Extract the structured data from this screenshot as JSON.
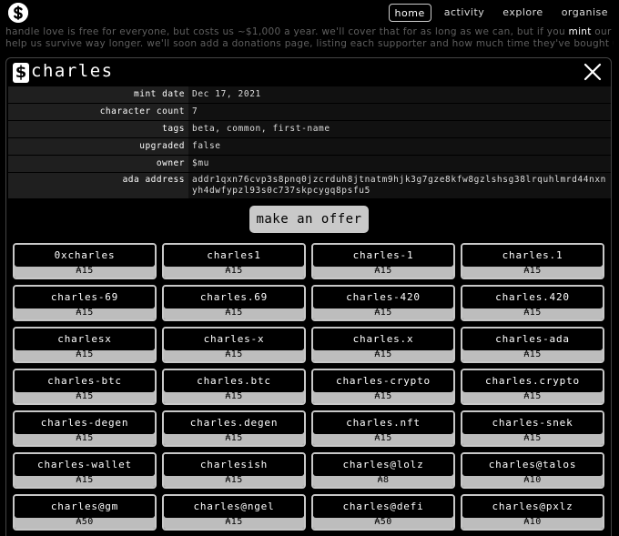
{
  "nav": {
    "logo_icon": "handle-logo-icon",
    "items": [
      {
        "label": "home",
        "active": true
      },
      {
        "label": "activity",
        "active": false
      },
      {
        "label": "explore",
        "active": false
      },
      {
        "label": "organise",
        "active": false
      }
    ]
  },
  "background": {
    "line1_before": "handle love is free for everyone, but costs us ~$1,000 a year. we'll cover that for as long as we can, but if you ",
    "line1_highlight": "mint",
    "line1_after": " our sub-handles it'll",
    "line2": "help us survive way longer. we'll soon add a donations page, listing each supporter and how much time they've bought us."
  },
  "modal": {
    "currency_symbol": "$",
    "handle_name": "charles",
    "close_icon": "close-icon",
    "info": {
      "mint_date": {
        "key": "mint date",
        "value": "Dec 17, 2021"
      },
      "character_count": {
        "key": "character count",
        "value": "7"
      },
      "tags": {
        "key": "tags",
        "value": "beta, common, first-name"
      },
      "upgraded": {
        "key": "upgraded",
        "value": "false"
      },
      "owner": {
        "key": "owner",
        "value": "$mu"
      },
      "ada_address": {
        "key": "ada address",
        "value": "addr1qxn76cvp3s8pnq0jzcrduh8jtnatm9hjk3g7gze8kfw8gzlshsg38lrquhlmrd44nxnyh4dwfypzl93s0c737skpcygq8psfu5"
      }
    },
    "offer_button": "make an offer",
    "sub_handles": [
      {
        "name": "0xcharles",
        "price": "₳15"
      },
      {
        "name": "charles1",
        "price": "₳15"
      },
      {
        "name": "charles-1",
        "price": "₳15"
      },
      {
        "name": "charles.1",
        "price": "₳15"
      },
      {
        "name": "charles-69",
        "price": "₳15"
      },
      {
        "name": "charles.69",
        "price": "₳15"
      },
      {
        "name": "charles-420",
        "price": "₳15"
      },
      {
        "name": "charles.420",
        "price": "₳15"
      },
      {
        "name": "charlesx",
        "price": "₳15"
      },
      {
        "name": "charles-x",
        "price": "₳15"
      },
      {
        "name": "charles.x",
        "price": "₳15"
      },
      {
        "name": "charles-ada",
        "price": "₳15"
      },
      {
        "name": "charles-btc",
        "price": "₳15"
      },
      {
        "name": "charles.btc",
        "price": "₳15"
      },
      {
        "name": "charles-crypto",
        "price": "₳15"
      },
      {
        "name": "charles.crypto",
        "price": "₳15"
      },
      {
        "name": "charles-degen",
        "price": "₳15"
      },
      {
        "name": "charles.degen",
        "price": "₳15"
      },
      {
        "name": "charles.nft",
        "price": "₳15"
      },
      {
        "name": "charles-snek",
        "price": "₳15"
      },
      {
        "name": "charles-wallet",
        "price": "₳15"
      },
      {
        "name": "charlesish",
        "price": "₳15"
      },
      {
        "name": "charles@lolz",
        "price": "₳8"
      },
      {
        "name": "charles@talos",
        "price": "₳10"
      },
      {
        "name": "charles@gm",
        "price": "₳50"
      },
      {
        "name": "charles@ngel",
        "price": "₳15"
      },
      {
        "name": "charles@defi",
        "price": "₳50"
      },
      {
        "name": "charles@pxlz",
        "price": "₳10"
      }
    ]
  }
}
